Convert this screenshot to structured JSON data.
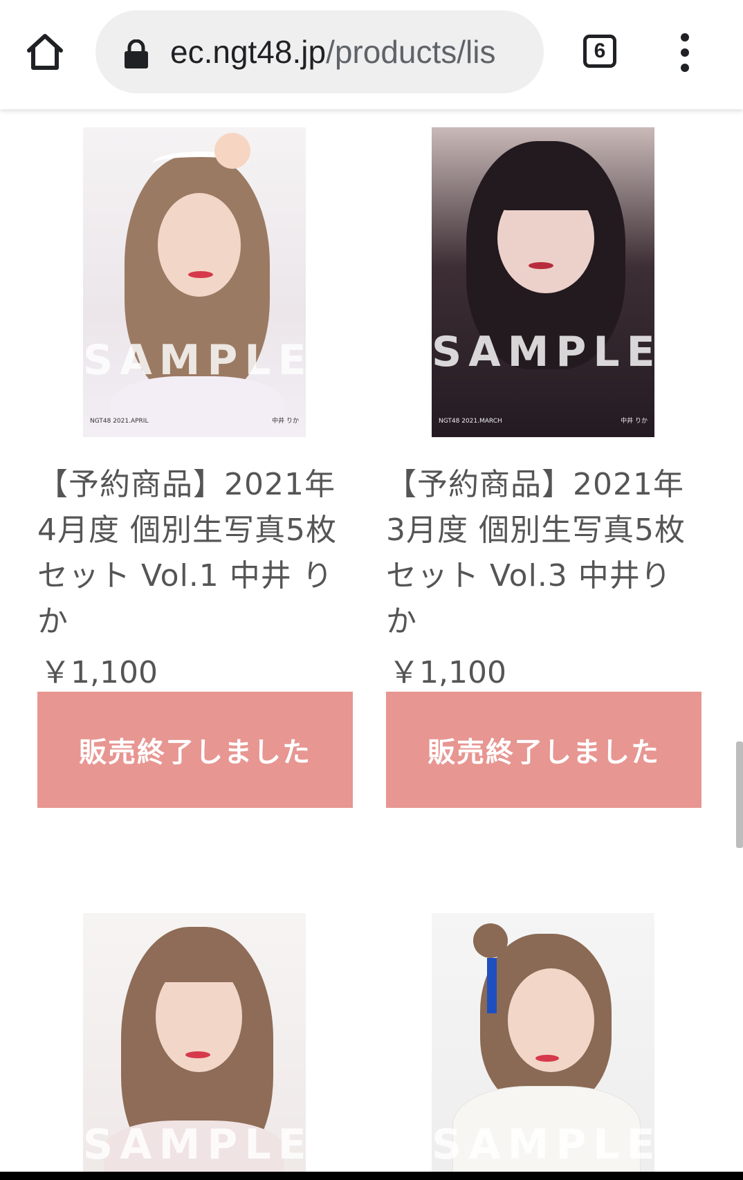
{
  "browser": {
    "url_host": "ec.ngt48.jp",
    "url_path": "/products/lis",
    "tab_count": "6"
  },
  "products": [
    {
      "title": "【予約商品】2021年4月度 個別生写真5枚セット Vol.1 中井 りか",
      "price": "￥1,100",
      "button_label": "販売終了しました",
      "watermark": "SAMPLE",
      "photo_caption_left": "NGT48 2021.APRIL",
      "photo_caption_right": "中井 りか"
    },
    {
      "title": "【予約商品】2021年3月度 個別生写真5枚セット Vol.3 中井りか",
      "price": "￥1,100",
      "button_label": "販売終了しました",
      "watermark": "SAMPLE",
      "photo_caption_left": "NGT48 2021.MARCH",
      "photo_caption_right": "中井 りか"
    },
    {
      "watermark": "SAMPLE"
    },
    {
      "watermark": "SAMPLE"
    }
  ],
  "colors": {
    "soldout_button": "#e79692",
    "text": "#555555"
  }
}
